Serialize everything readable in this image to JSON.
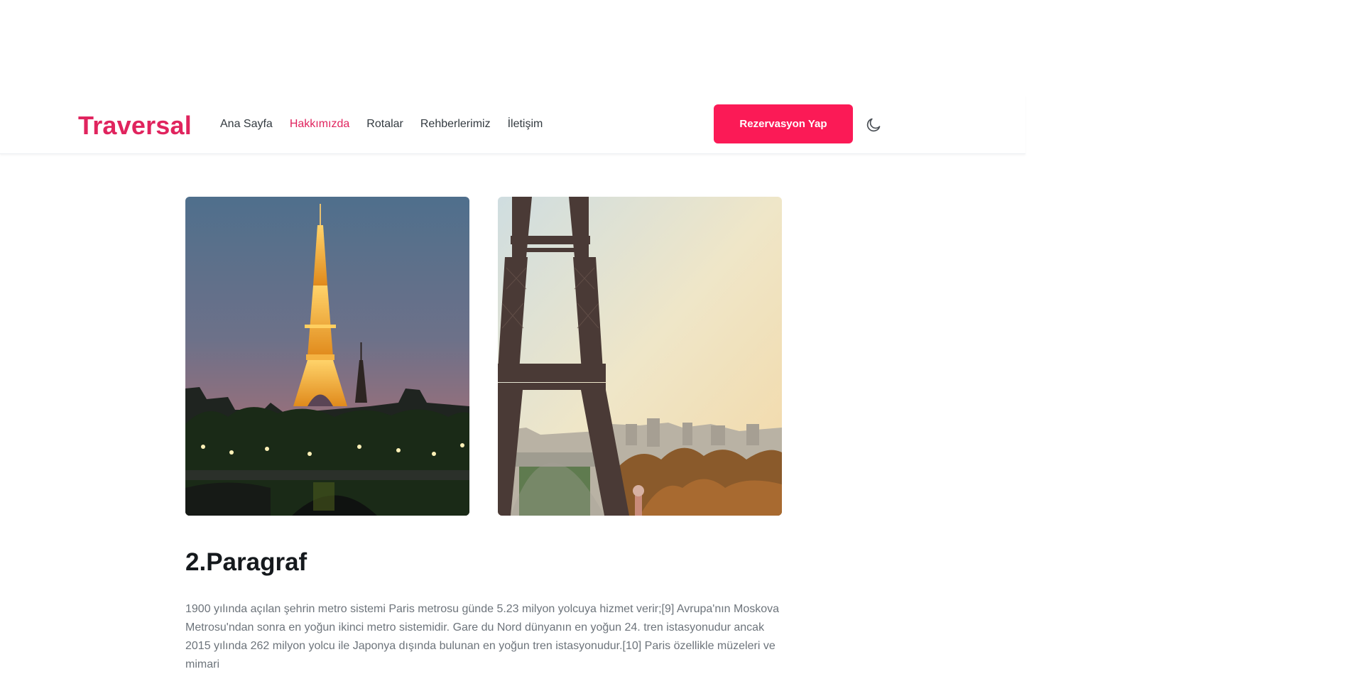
{
  "header": {
    "logo": "Traversal",
    "nav": [
      {
        "label": "Ana Sayfa",
        "active": false
      },
      {
        "label": "Hakkımızda",
        "active": true
      },
      {
        "label": "Rotalar",
        "active": false
      },
      {
        "label": "Rehberlerimiz",
        "active": false
      },
      {
        "label": "İletişim",
        "active": false
      }
    ],
    "cta_label": "Rezervasyon Yap",
    "theme_icon": "moon-icon"
  },
  "content": {
    "heading": "2.Paragraf",
    "paragraph": "1900 yılında açılan şehrin metro sistemi Paris metrosu günde 5.23 milyon yolcuya hizmet verir;[9] Avrupa'nın Moskova Metrosu'ndan sonra en yoğun ikinci metro sistemidir. Gare du Nord dünyanın en yoğun 24. tren istasyonudur ancak 2015 yılında 262 milyon yolcu ile Japonya dışında bulunan en yoğun tren istasyonudur.[10] Paris özellikle müzeleri ve mimari"
  },
  "colors": {
    "brand": "#e0245e",
    "cta_background": "#fb1a56",
    "body_text": "#6d747b",
    "heading_text": "#15191d"
  }
}
